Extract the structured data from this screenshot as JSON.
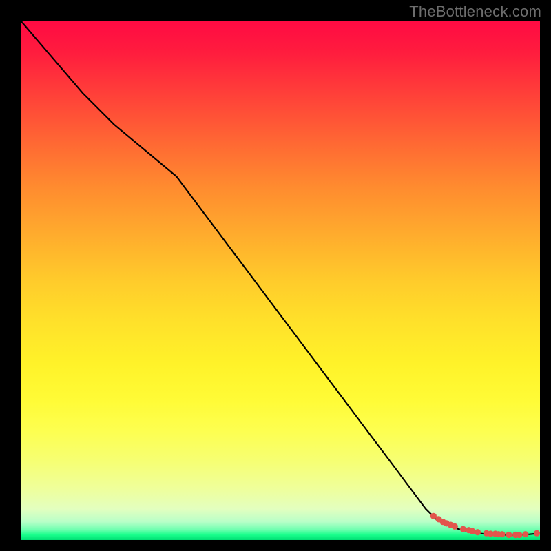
{
  "watermark": "TheBottleneck.com",
  "colors": {
    "watermark": "#6d6d6d",
    "curve": "#000000",
    "dot": "#e2554c",
    "gradient_top": "#ff0a43",
    "gradient_mid": "#fff229",
    "gradient_bottom": "#00de73",
    "page_bg": "#000000"
  },
  "chart_data": {
    "type": "line",
    "title": "",
    "xlabel": "",
    "ylabel": "",
    "xlim": [
      0,
      100
    ],
    "ylim": [
      0,
      100
    ],
    "grid": false,
    "legend": false,
    "annotations": [
      "TheBottleneck.com"
    ],
    "series": [
      {
        "name": "bottleneck-curve",
        "type": "line",
        "x": [
          0,
          6,
          12,
          18,
          24,
          30,
          36,
          42,
          48,
          54,
          60,
          66,
          72,
          78,
          80,
          82,
          84,
          86,
          88,
          90,
          92,
          94,
          96,
          98,
          100
        ],
        "y": [
          100,
          93,
          86,
          80,
          75,
          70,
          62,
          54,
          46,
          38,
          30,
          22,
          14,
          6,
          4,
          3,
          2.2,
          1.7,
          1.3,
          1.1,
          1.0,
          1.0,
          1.0,
          1.1,
          1.3
        ]
      },
      {
        "name": "selected-points",
        "type": "scatter",
        "x": [
          79.5,
          80.5,
          81.3,
          82.0,
          82.8,
          83.6,
          85.2,
          86.3,
          87.0,
          88.0,
          89.7,
          90.5,
          91.4,
          92.0,
          92.7,
          94.0,
          95.3,
          96.0,
          97.2,
          99.4
        ],
        "y": [
          4.6,
          4.0,
          3.5,
          3.2,
          2.9,
          2.6,
          2.1,
          1.9,
          1.7,
          1.5,
          1.3,
          1.2,
          1.2,
          1.1,
          1.1,
          1.0,
          1.0,
          1.0,
          1.1,
          1.3
        ]
      }
    ]
  }
}
